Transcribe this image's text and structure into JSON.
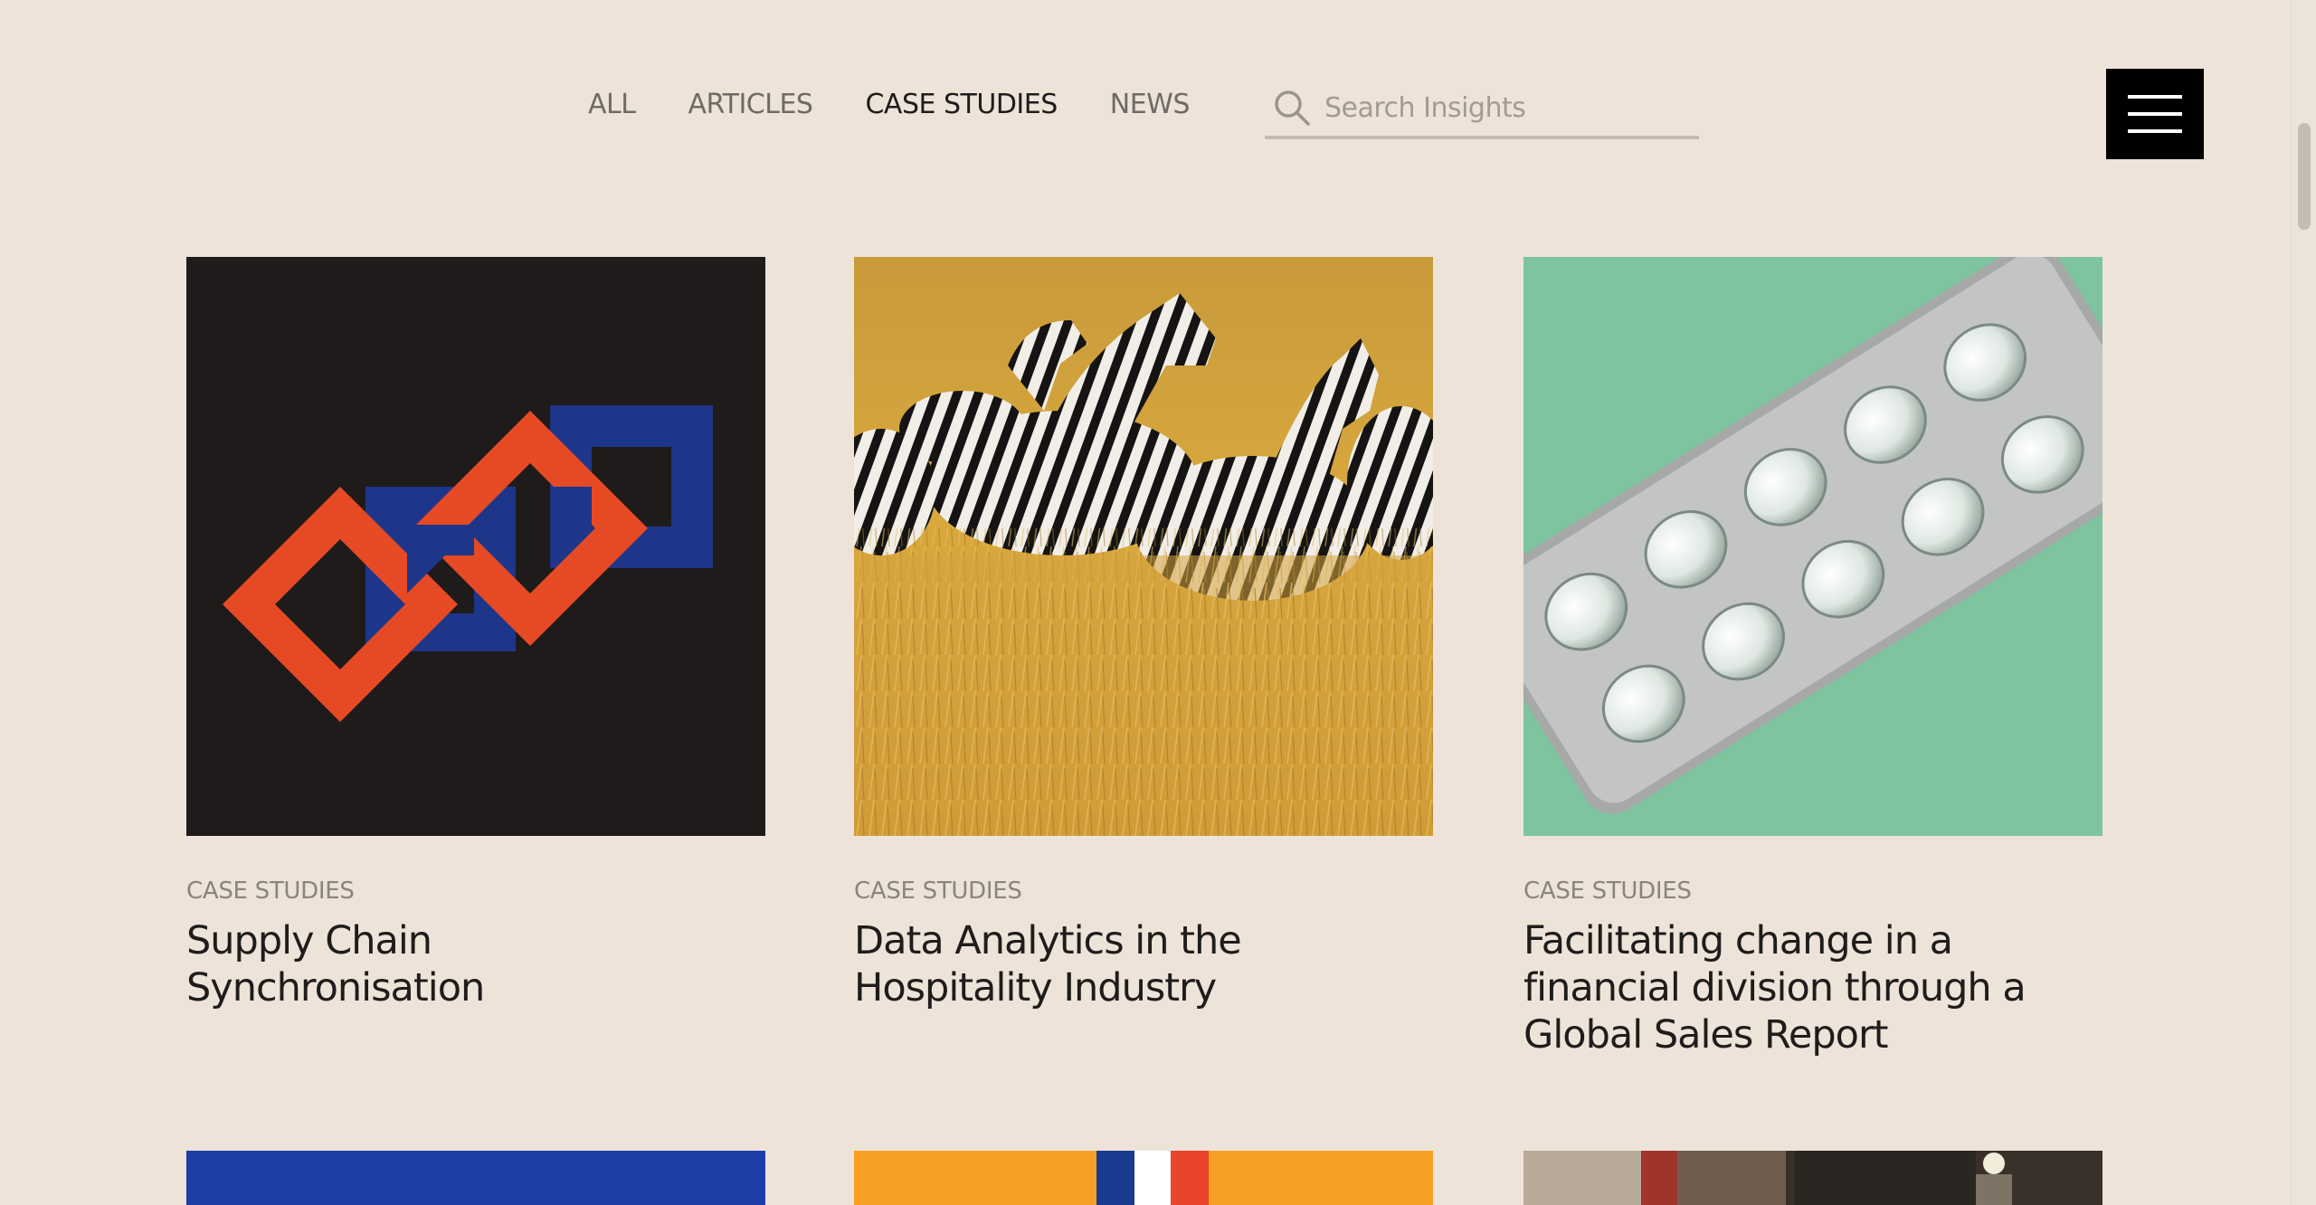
{
  "nav": {
    "filters": [
      {
        "label": "ALL",
        "active": false
      },
      {
        "label": "ARTICLES",
        "active": false
      },
      {
        "label": "CASE STUDIES",
        "active": true
      },
      {
        "label": "NEWS",
        "active": false
      }
    ],
    "search": {
      "placeholder": "Search Insights",
      "value": "",
      "icon": "search-icon"
    },
    "menu_icon": "hamburger-menu-icon"
  },
  "cards": [
    {
      "category": "CASE STUDIES",
      "title": "Supply Chain Synchronisation",
      "image": "chain-links-illustration"
    },
    {
      "category": "CASE STUDIES",
      "title": "Data Analytics in the Hospitality Industry",
      "image": "zebras-in-grass-photo"
    },
    {
      "category": "CASE STUDIES",
      "title": "Facilitating change in a financial division through a Global Sales Report",
      "image": "pill-blister-pack-photo"
    }
  ],
  "colors": {
    "background": "#ede3d9",
    "text": "#1f1c1b",
    "muted": "#8a847e",
    "accent_orange": "#e64a24",
    "accent_blue": "#1f3a8f"
  }
}
